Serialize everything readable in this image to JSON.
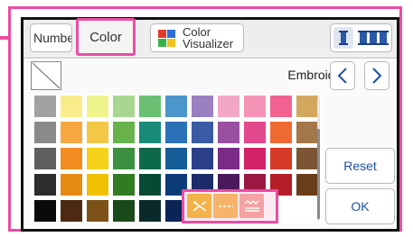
{
  "tabs": {
    "number_label": "Numbe",
    "color_label": "Color",
    "visualizer_label": "Color\nVisualizer"
  },
  "header": {
    "title": "Embroidery",
    "prev_label": "<",
    "next_label": ">"
  },
  "buttons": {
    "reset_label": "Reset",
    "ok_label": "OK"
  },
  "icons": {
    "visualizer": "color-grid-icon",
    "spool_single": "single-spool-icon",
    "spool_multi": "multi-spool-icon",
    "no_color": "no-color-icon",
    "special_1": "random-stitch-icon",
    "special_2": "dashed-stitch-icon",
    "special_3": "zigzag-stitch-icon"
  },
  "colors": {
    "accent_pink": "#ec4ba2",
    "button_text_blue": "#1c4f9e",
    "palette": [
      [
        "#a2a2a2",
        "#f9ec8a",
        "#f0f48c",
        "#a8d88f",
        "#6abf73",
        "#4b97cc",
        "#9a7fc1",
        "#f2a7c4",
        "#f594b6",
        "#f26290",
        "#d4a75f"
      ],
      [
        "#8a8a8a",
        "#f6a742",
        "#f3c847",
        "#68b24c",
        "#178a7a",
        "#2b71b8",
        "#3a5aa6",
        "#9a4fa1",
        "#e2488c",
        "#ef6a33",
        "#a4774a"
      ],
      [
        "#5e5e5e",
        "#f28b20",
        "#f6d21b",
        "#3c9040",
        "#0c6a4a",
        "#165e98",
        "#2b3f8a",
        "#7a2c88",
        "#d22268",
        "#d73a27",
        "#7a5634"
      ],
      [
        "#2c2c2c",
        "#e78a13",
        "#efc000",
        "#317b22",
        "#064a36",
        "#0c3c78",
        "#1c2b6a",
        "#4a1a5c",
        "#9c1844",
        "#b51e26",
        "#6a3e18"
      ],
      [
        "#0a0a0a",
        "#4c2a12",
        "#7c5218",
        "#1a4a1a",
        "#0a2a2a",
        "#0a2456",
        "#14186a"
      ]
    ],
    "specials": [
      "#f4b24a",
      "#f6b36a",
      "#f4a2a2"
    ]
  }
}
